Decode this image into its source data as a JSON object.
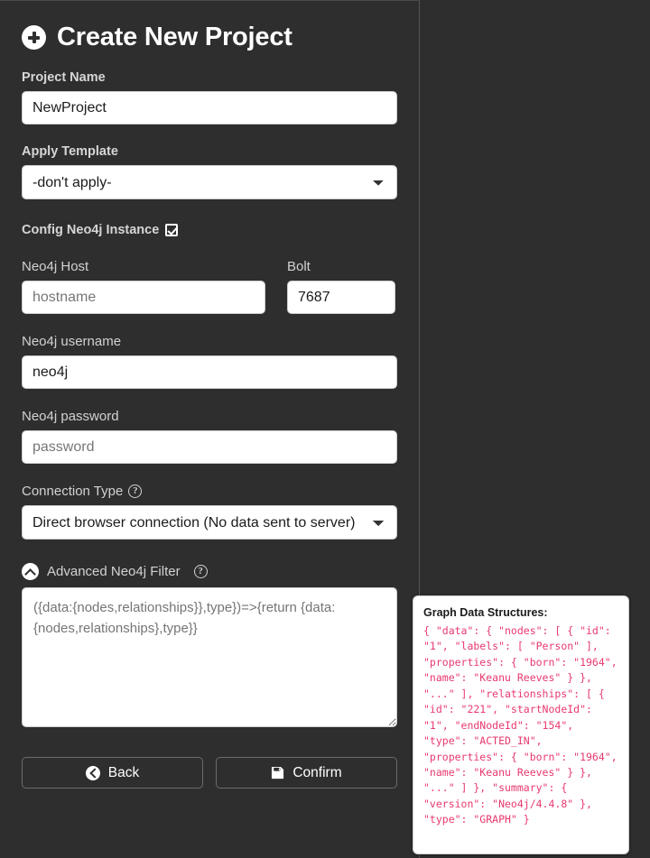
{
  "header": {
    "title": "Create New Project",
    "icon": "plus-circle-icon"
  },
  "form": {
    "project_name": {
      "label": "Project Name",
      "value": "NewProject",
      "placeholder": "Project Name"
    },
    "apply_template": {
      "label": "Apply Template",
      "selected": "-don't apply-",
      "options": [
        "-don't apply-"
      ],
      "icon": "chevron-down-icon"
    },
    "config_instance": {
      "label": "Config Neo4j Instance",
      "icon": "checkbox-checked-icon",
      "checked": true
    },
    "neo4j_host": {
      "label": "Neo4j Host",
      "value": "",
      "placeholder": "hostname"
    },
    "bolt": {
      "label": "Bolt",
      "value": "7687",
      "placeholder": "7687"
    },
    "neo4j_username": {
      "label": "Neo4j username",
      "value": "neo4j",
      "placeholder": "neo4j"
    },
    "neo4j_password": {
      "label": "Neo4j password",
      "value": "",
      "placeholder": "password"
    },
    "connection_type": {
      "label": "Connection Type",
      "help_icon": "question-circle-icon",
      "help_glyph": "?",
      "selected": "Direct browser connection (No data sent to server)",
      "options": [
        "Direct browser connection (No data sent to server)"
      ],
      "icon": "chevron-down-icon"
    },
    "advanced_filter": {
      "label": "Advanced Neo4j Filter",
      "toggle_icon": "chevron-up-circle-icon",
      "help_icon": "question-circle-icon",
      "help_glyph": "?",
      "value": "",
      "placeholder": "({data:{nodes,relationships}},type})=>{return {data:{nodes,relationships},type}}"
    }
  },
  "buttons": {
    "back": {
      "label": "Back",
      "icon": "back-circle-icon"
    },
    "confirm": {
      "label": "Confirm",
      "icon": "save-floppy-icon"
    }
  },
  "tooltip": {
    "title": "Graph Data Structures:",
    "code": "{ \"data\": { \"nodes\": [ { \"id\": \"1\", \"labels\": [ \"Person\" ], \"properties\": { \"born\": \"1964\", \"name\": \"Keanu Reeves\" } }, \"...\" ], \"relationships\": [ { \"id\": \"221\", \"startNodeId\": \"1\", \"endNodeId\": \"154\", \"type\": \"ACTED_IN\", \"properties\": { \"born\": \"1964\", \"name\": \"Keanu Reeves\" } }, \"...\" ] }, \"summary\": { \"version\": \"Neo4j/4.4.8\" }, \"type\": \"GRAPH\" }"
  },
  "colors": {
    "background": "#2e2e2e",
    "accent_code": "#e8396f",
    "input_background": "#ffffff",
    "label_text": "#d6d6d6"
  }
}
